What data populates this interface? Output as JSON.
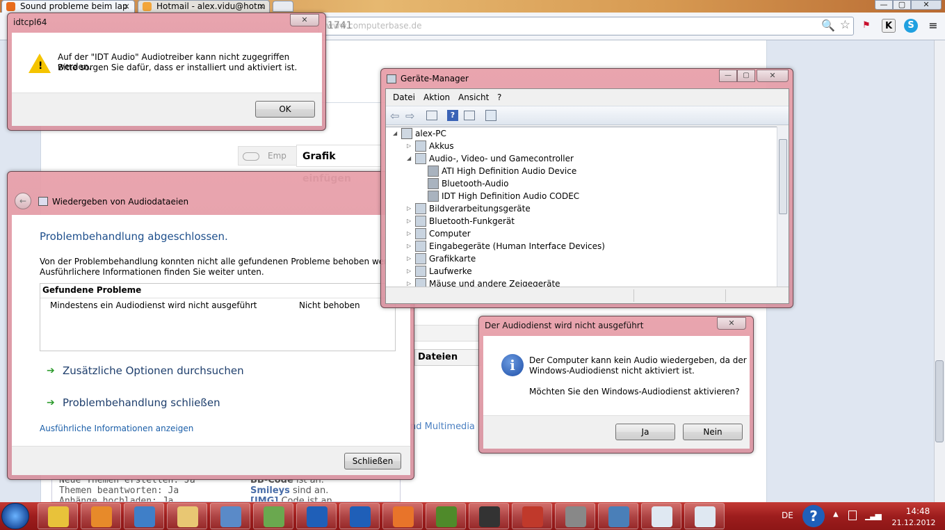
{
  "browser": {
    "tabs": [
      {
        "title": "Sound probleme beim lap",
        "close": "×"
      },
      {
        "title": "Hotmail - alex.vidu@hotm",
        "close": "×"
      }
    ],
    "window_controls": [
      "—",
      "▢",
      "✕"
    ],
    "url_fragment": "1741",
    "url_prefix": "www.computerbase.de",
    "toolbar_icons": [
      "zoom-icon",
      "star-icon",
      "flag-icon",
      "k-icon",
      "skype-icon",
      "menu-icon"
    ]
  },
  "page": {
    "grafik_einfuegen": "Grafik einfügen",
    "emp_label": "Emp",
    "dateien_ausw": "Dateien ausw",
    "und_multimedia": "nd Multimedia",
    "rules": [
      {
        "left": "Neue Themen erstellen: Ja",
        "right_bold": "BB-Code",
        "right": "ist an."
      },
      {
        "left": "Themen beantworten: Ja",
        "right_bold": "Smileys",
        "right": "sind an."
      },
      {
        "left": "Anhänge hochladen: Ja",
        "right_bold": "[IMG]",
        "right": "Code ist an."
      }
    ]
  },
  "idt_dialog": {
    "title": "idtcpl64",
    "close": "✕",
    "message_line1": "Auf der \"IDT Audio\" Audiotreiber kann nicht zugegriffen werden.",
    "message_line2": "Bitte sorgen Sie dafür, dass er installiert und aktiviert ist.",
    "ok": "OK"
  },
  "troubleshooter": {
    "title": "Wiedergeben von Audiodataeien",
    "heading": "Problembehandlung abgeschlossen.",
    "desc_line1": "Von der Problembehandlung konnten nicht alle gefundenen Probleme behoben werden.",
    "desc_line2": "Ausführlichere Informationen finden Sie weiter unten.",
    "table_header": "Gefundene Probleme",
    "problem": "Mindestens ein Audiodienst wird nicht ausgeführt",
    "status": "Nicht behoben",
    "option1": "Zusätzliche Optionen durchsuchen",
    "option2": "Problembehandlung schließen",
    "details_link": "Ausführliche Informationen anzeigen",
    "close_btn": "Schließen"
  },
  "device_manager": {
    "title": "Geräte-Manager",
    "menu": [
      "Datei",
      "Aktion",
      "Ansicht",
      "?"
    ],
    "root": "alex-PC",
    "nodes": [
      {
        "label": "Akkus",
        "level": 1,
        "expanded": false
      },
      {
        "label": "Audio-, Video- und Gamecontroller",
        "level": 1,
        "expanded": true
      },
      {
        "label": "ATI High Definition Audio Device",
        "level": 2
      },
      {
        "label": "Bluetooth-Audio",
        "level": 2
      },
      {
        "label": "IDT High Definition Audio CODEC",
        "level": 2
      },
      {
        "label": "Bildverarbeitungsgeräte",
        "level": 1,
        "expanded": false
      },
      {
        "label": "Bluetooth-Funkgerät",
        "level": 1,
        "expanded": false
      },
      {
        "label": "Computer",
        "level": 1,
        "expanded": false
      },
      {
        "label": "Eingabegeräte (Human Interface Devices)",
        "level": 1,
        "expanded": false
      },
      {
        "label": "Grafikkarte",
        "level": 1,
        "expanded": false
      },
      {
        "label": "Laufwerke",
        "level": 1,
        "expanded": false
      },
      {
        "label": "Mäuse und andere Zeigegeräte",
        "level": 1,
        "expanded": false
      }
    ]
  },
  "audio_dialog": {
    "title": "Der Audiodienst wird nicht ausgeführt",
    "close": "✕",
    "line1": "Der Computer kann kein Audio wiedergeben, da der",
    "line2": "Windows-Audiodienst nicht aktiviert ist.",
    "question": "Möchten Sie den Windows-Audiodienst aktivieren?",
    "yes": "Ja",
    "no": "Nein"
  },
  "taskbar": {
    "lang": "DE",
    "time": "14:48",
    "date": "21.12.2012",
    "apps": [
      "chrome-icon",
      "media-player-icon",
      "task-icon",
      "explorer-icon",
      "control-panel-icon",
      "users-icon",
      "help-icon",
      "help-icon",
      "firefox-icon",
      "minecraft-icon",
      "steam-icon",
      "toolbox-icon",
      "camera-icon",
      "network-icon",
      "document-icon",
      "document-icon"
    ]
  },
  "colors": {
    "aero_frame": "#e2a0aa",
    "taskbar": "#b02a27",
    "link_blue": "#1a5ea8",
    "heading_blue": "#1e4f8c"
  }
}
